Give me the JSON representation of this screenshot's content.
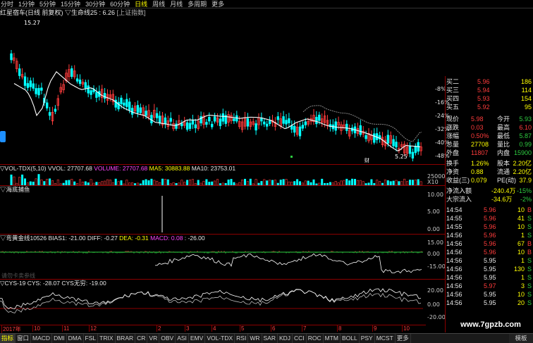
{
  "topbar": {
    "periods": [
      "分时",
      "1分钟",
      "5分钟",
      "15分钟",
      "30分钟",
      "60分钟",
      "日线",
      "周线",
      "月线",
      "多周期",
      "更多"
    ],
    "selected": 6
  },
  "main_title": {
    "name": "红星宿车(日线 前复权)",
    "indicator": "▽生命线25 : 6.26",
    "index": "[上证指数]"
  },
  "main_chart": {
    "high_label": "15.27",
    "low_label": "5.25",
    "marker": "财",
    "percent_ticks": [
      "-8%",
      "-16%",
      "-24%",
      "-32%",
      "-40%",
      "-48%"
    ],
    "up_color": "#ff3c3c",
    "down_color": "#00ffff",
    "ma_color": "#ffffff"
  },
  "panel_vol": {
    "title": "▽VOL-TDX(5,10)",
    "vvol": "VVOL: 27707.68",
    "volume": "VOLUME: 27707.68",
    "ma5": "MA5: 30883.88",
    "ma10": "MA10: 23753.01",
    "tick": "25000",
    "unit": "X10"
  },
  "panel_sea": {
    "title": "▽海底捕鱼",
    "ticks": [
      "10.00",
      "5.00",
      "0.00"
    ]
  },
  "panel_macd": {
    "title": "▽弯黄金线10526",
    "bias": "BIAS1: -21.00",
    "diff": "DIFF: -0.27",
    "dea": "DEA: -0.31",
    "macd": "MACD: 0.08",
    "extra": ": -26.00",
    "ticks": [
      "15.00",
      "0.00",
      "-15.00"
    ],
    "sub_label": "请勿卡卖参线"
  },
  "panel_cys": {
    "title": "▽CYS-19",
    "value": "CYS: -28.07",
    "value2": "CYS无穷: -19.00",
    "ticks": [
      "20.00",
      "0.00",
      "-20.00"
    ]
  },
  "xaxis": {
    "labels": [
      "2017年",
      "10",
      "11",
      "12",
      "2",
      "3",
      "4",
      "5",
      "6",
      "7",
      "8",
      "9",
      "10"
    ]
  },
  "quote": {
    "asks": [
      {
        "label": "买二",
        "price": "5.96",
        "vol": "186"
      },
      {
        "label": "买三",
        "price": "5.94",
        "vol": "114"
      },
      {
        "label": "买四",
        "price": "5.93",
        "vol": "154"
      },
      {
        "label": "买五",
        "price": "5.92",
        "vol": "95"
      }
    ],
    "rows": [
      {
        "l1": "现价",
        "v1": "5.98",
        "l2": "今开",
        "v2": "5.93"
      },
      {
        "l1": "涨跌",
        "v1": "0.03",
        "l2": "最高",
        "v2": "6.10"
      },
      {
        "l1": "涨幅",
        "v1": "0.50%",
        "l2": "最低",
        "v2": "5.87"
      },
      {
        "l1": "总量",
        "v1": "27708",
        "l2": "量比",
        "v2": "0.99"
      },
      {
        "l1": "外盘",
        "v1": "11807",
        "l2": "内盘",
        "v2": "15900"
      },
      {
        "l1": "换手",
        "v1": "1.26%",
        "l2": "股本",
        "v2": "2.20亿"
      },
      {
        "l1": "净资",
        "v1": "0.88",
        "l2": "流通",
        "v2": "2.20亿"
      },
      {
        "l1": "收益(三)",
        "v1": "0.079",
        "l2": "PE(动)",
        "v2": "37.9"
      }
    ],
    "flow": [
      {
        "label": "净流入额",
        "value": "-240.4万",
        "pct": "-15%"
      },
      {
        "label": "大宗流入",
        "value": "-34.6万",
        "pct": "-2%"
      }
    ],
    "ticks": [
      {
        "time": "14:54",
        "price": "5.96",
        "vol": "10",
        "dir": "B"
      },
      {
        "time": "14:55",
        "price": "5.96",
        "vol": "41",
        "dir": "S"
      },
      {
        "time": "14:55",
        "price": "5.96",
        "vol": "10",
        "dir": "S"
      },
      {
        "time": "14:56",
        "price": "5.96",
        "vol": "1",
        "dir": "S"
      },
      {
        "time": "14:56",
        "price": "5.96",
        "vol": "67",
        "dir": "B"
      },
      {
        "time": "14:56",
        "price": "5.96",
        "vol": "10",
        "dir": "B"
      },
      {
        "time": "14:56",
        "price": "5.95",
        "vol": "1",
        "dir": "S"
      },
      {
        "time": "14:56",
        "price": "5.95",
        "vol": "130",
        "dir": "S"
      },
      {
        "time": "14:56",
        "price": "5.95",
        "vol": "1",
        "dir": "S"
      },
      {
        "time": "14:56",
        "price": "5.97",
        "vol": "3",
        "dir": "S"
      },
      {
        "time": "14:56",
        "price": "5.95",
        "vol": "10",
        "dir": "S"
      },
      {
        "time": "14:56",
        "price": "5.95",
        "vol": "20",
        "dir": "S"
      }
    ]
  },
  "bottom_tabs": [
    "指标",
    "窗口",
    "MACD",
    "DMI",
    "DMA",
    "FSL",
    "TRIX",
    "BRAR",
    "CR",
    "VR",
    "OBV",
    "ASI",
    "EMV",
    "VOL-TDX",
    "RSI",
    "WR",
    "SAR",
    "KDJ",
    "CCI",
    "ROC",
    "MTM",
    "BOLL",
    "PSY",
    "MCST",
    "更多"
  ],
  "bottom_right": "模板",
  "watermark": "www.7gpzb.com"
}
